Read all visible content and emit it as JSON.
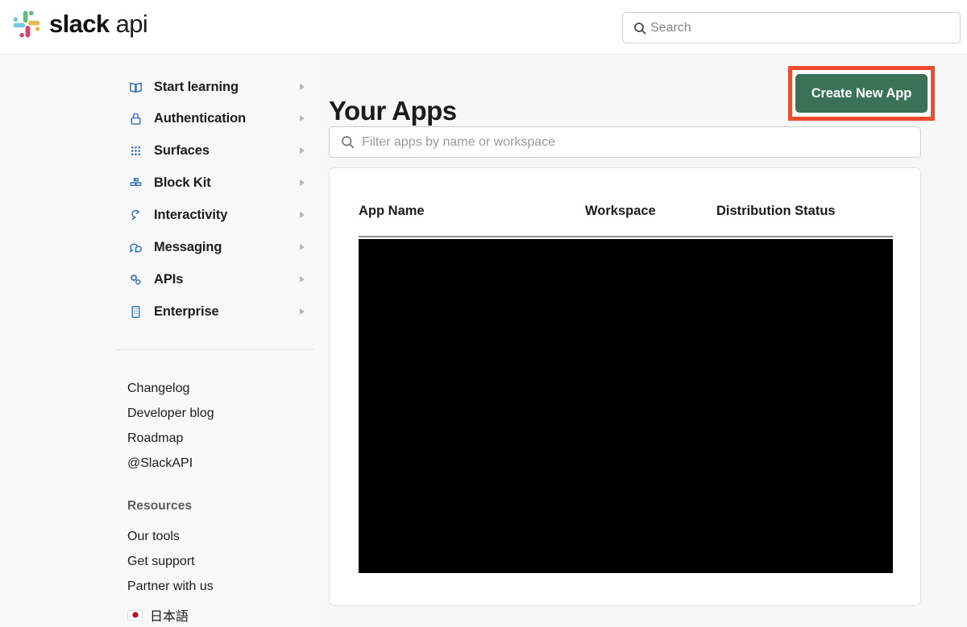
{
  "header": {
    "brand_bold": "slack",
    "brand_light": "api",
    "brand_mark_icon": "slack-logo-icon",
    "brand_colors": {
      "cyan": "#6ECADC",
      "green": "#5FBC7D",
      "yellow": "#E9B94B",
      "red": "#D8436C"
    },
    "search": {
      "icon": "search-icon",
      "placeholder": "Search",
      "value": ""
    }
  },
  "sidebar": {
    "nav_items": [
      {
        "label": "Start learning",
        "icon": "book-open-icon",
        "caret": "chevron-right-icon"
      },
      {
        "label": "Authentication",
        "icon": "lock-icon",
        "caret": "chevron-right-icon"
      },
      {
        "label": "Surfaces",
        "icon": "grid-dots-icon",
        "caret": "chevron-right-icon"
      },
      {
        "label": "Block Kit",
        "icon": "blocks-icon",
        "caret": "chevron-right-icon"
      },
      {
        "label": "Interactivity",
        "icon": "plug-icon",
        "caret": "chevron-right-icon"
      },
      {
        "label": "Messaging",
        "icon": "speech-bubble-icon",
        "caret": "chevron-right-icon"
      },
      {
        "label": "APIs",
        "icon": "gears-icon",
        "caret": "chevron-right-icon"
      },
      {
        "label": "Enterprise",
        "icon": "building-icon",
        "caret": "chevron-right-icon"
      }
    ],
    "links": [
      {
        "label": "Changelog"
      },
      {
        "label": "Developer blog"
      },
      {
        "label": "Roadmap"
      },
      {
        "label": "@SlackAPI"
      }
    ],
    "resources_heading": "Resources",
    "resource_links": [
      {
        "label": "Our tools"
      },
      {
        "label": "Get support"
      },
      {
        "label": "Partner with us"
      }
    ],
    "language": {
      "label": "日本語",
      "flag_icon": "flag-japan-icon"
    }
  },
  "main": {
    "title": "Your Apps",
    "create_button": {
      "label": "Create New App",
      "color": "#3A7258",
      "highlight_color": "#EF4B2C"
    },
    "filter": {
      "icon": "search-icon",
      "placeholder": "Filter apps by name or workspace",
      "value": ""
    },
    "apps_table": {
      "columns": [
        "App Name",
        "Workspace",
        "Distribution Status"
      ],
      "rows": [],
      "redacted": true
    }
  }
}
